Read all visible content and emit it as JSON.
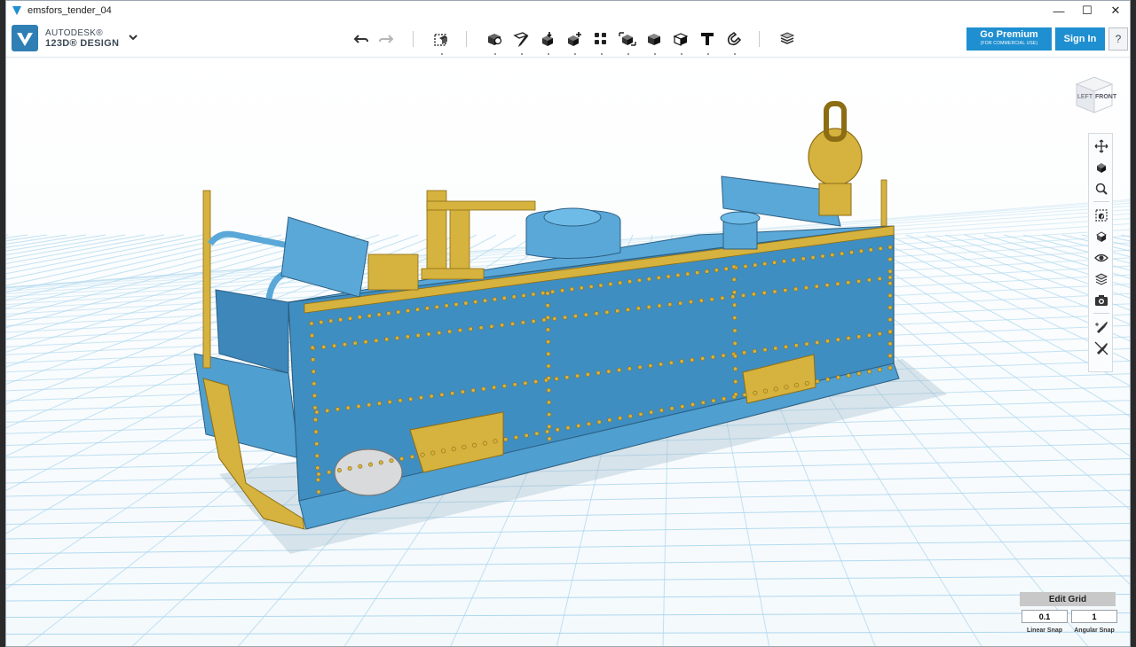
{
  "window": {
    "title": "emsfors_tender_04"
  },
  "window_controls": {
    "minimize": "—",
    "maximize": "☐",
    "close": "✕"
  },
  "brand": {
    "line1": "AUTODESK®",
    "line2": "123D® DESIGN"
  },
  "toolbar": {
    "undo_icon": "undo-icon",
    "redo_icon": "redo-icon",
    "tools": [
      "transform-icon",
      "primitives-icon",
      "sketch-icon",
      "construct-icon",
      "modify-icon",
      "pattern-icon",
      "group-icon",
      "combine-icon",
      "measure-icon",
      "text-icon",
      "snap-icon",
      "material-icon"
    ]
  },
  "account": {
    "premium_title": "Go Premium",
    "premium_sub": "(FOR COMMERCIAL USE)",
    "signin": "Sign In",
    "help": "?"
  },
  "viewcube": {
    "left_face": "LEFT",
    "front_face": "FRONT"
  },
  "navbar": {
    "tools": [
      "pan",
      "orbit",
      "zoom",
      "fit",
      "views",
      "visibility",
      "materials",
      "screenshot",
      "tool-a",
      "tool-b"
    ]
  },
  "grid": {
    "edit_label": "Edit Grid",
    "linear_snap_value": "0.1",
    "angular_snap_value": "1",
    "linear_snap_label": "Linear Snap",
    "angular_snap_label": "Angular Snap"
  },
  "colors": {
    "accent": "#1e8fd0",
    "model_blue": "#3f8ec2",
    "model_brass": "#d6b23e",
    "grid_line": "#a7d4ec"
  }
}
